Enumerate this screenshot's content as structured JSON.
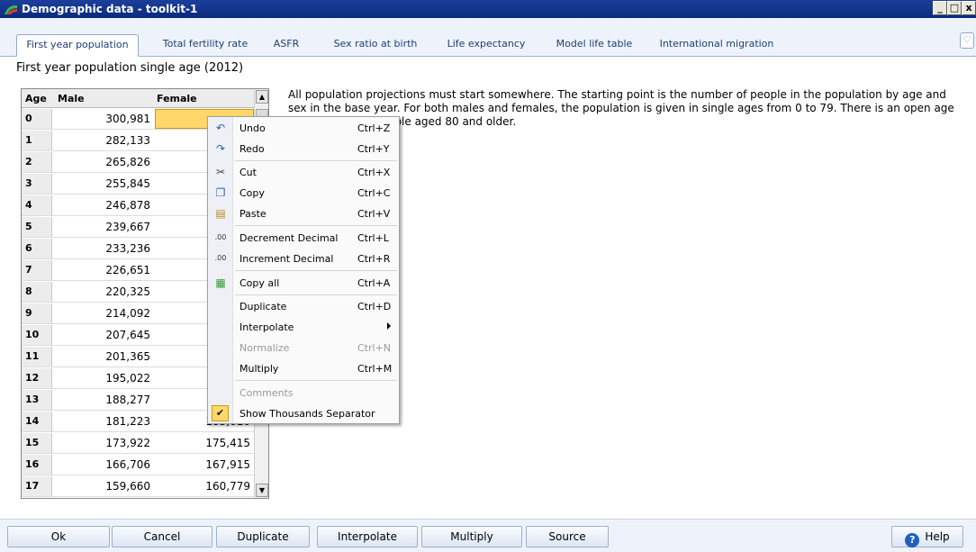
{
  "window": {
    "title": "Demographic data - toolkit-1",
    "btn_min": "_",
    "btn_max": "□",
    "btn_close": "x"
  },
  "tabs": [
    "First year population",
    "Total fertility rate",
    "ASFR",
    "Sex ratio at birth",
    "Life expectancy",
    "Model life table",
    "International migration"
  ],
  "section_title": "First year population single age (2012)",
  "grid": {
    "headers": [
      "Age",
      "Male",
      "Female"
    ],
    "rows": [
      {
        "age": "0",
        "male": "300,981",
        "female": ""
      },
      {
        "age": "1",
        "male": "282,133",
        "female": ""
      },
      {
        "age": "2",
        "male": "265,826",
        "female": ""
      },
      {
        "age": "3",
        "male": "255,845",
        "female": ""
      },
      {
        "age": "4",
        "male": "246,878",
        "female": ""
      },
      {
        "age": "5",
        "male": "239,667",
        "female": ""
      },
      {
        "age": "6",
        "male": "233,236",
        "female": ""
      },
      {
        "age": "7",
        "male": "226,651",
        "female": ""
      },
      {
        "age": "8",
        "male": "220,325",
        "female": ""
      },
      {
        "age": "9",
        "male": "214,092",
        "female": ""
      },
      {
        "age": "10",
        "male": "207,645",
        "female": ""
      },
      {
        "age": "11",
        "male": "201,365",
        "female": ""
      },
      {
        "age": "12",
        "male": "195,022",
        "female": ""
      },
      {
        "age": "13",
        "male": "188,277",
        "female": ""
      },
      {
        "age": "14",
        "male": "181,223",
        "female": "183,010"
      },
      {
        "age": "15",
        "male": "173,922",
        "female": "175,415"
      },
      {
        "age": "16",
        "male": "166,706",
        "female": "167,915"
      },
      {
        "age": "17",
        "male": "159,660",
        "female": "160,779"
      }
    ]
  },
  "description": "All population projections must start somewhere. The starting point is the number of people in the population by age and sex in the base year. For both males and females, the population is given in single ages from 0 to 79. There is an open age group for those people aged 80 and older.",
  "context_menu": {
    "items": [
      {
        "label": "Undo",
        "shortcut": "Ctrl+Z"
      },
      {
        "label": "Redo",
        "shortcut": "Ctrl+Y"
      },
      {
        "label": "Cut",
        "shortcut": "Ctrl+X"
      },
      {
        "label": "Copy",
        "shortcut": "Ctrl+C"
      },
      {
        "label": "Paste",
        "shortcut": "Ctrl+V"
      },
      {
        "label": "Decrement Decimal",
        "shortcut": "Ctrl+L"
      },
      {
        "label": "Increment Decimal",
        "shortcut": "Ctrl+R"
      },
      {
        "label": "Copy all",
        "shortcut": "Ctrl+A"
      },
      {
        "label": "Duplicate",
        "shortcut": "Ctrl+D"
      },
      {
        "label": "Interpolate",
        "shortcut": ""
      },
      {
        "label": "Normalize",
        "shortcut": "Ctrl+N"
      },
      {
        "label": "Multiply",
        "shortcut": "Ctrl+M"
      },
      {
        "label": "Comments",
        "shortcut": ""
      },
      {
        "label": "Show Thousands Separator",
        "shortcut": ""
      }
    ]
  },
  "bottom_buttons": [
    "Ok",
    "Cancel",
    "Duplicate",
    "Interpolate",
    "Multiply",
    "Source"
  ],
  "help_label": "Help",
  "colors": {
    "titlebar": "#0a2a7d",
    "selected_cell": "#ffd76b",
    "tab_text": "#1b3f7a"
  }
}
